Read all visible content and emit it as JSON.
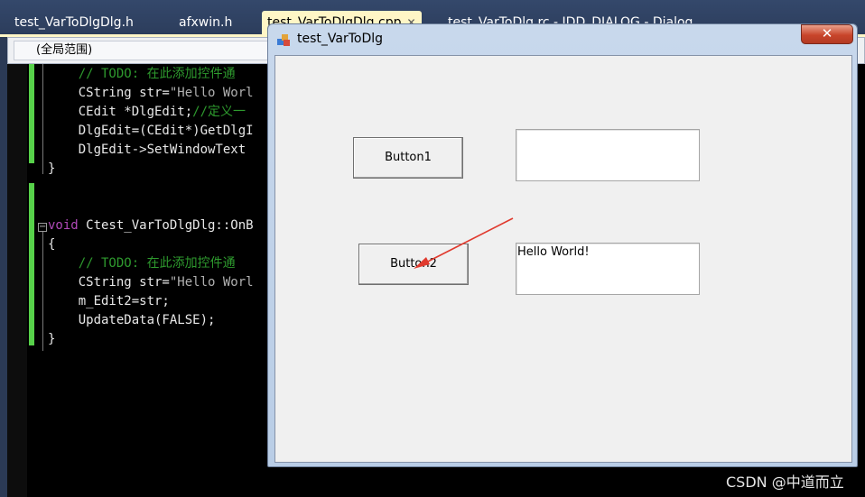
{
  "ide": {
    "tabs": [
      {
        "label": "test_VarToDlgDlg.h"
      },
      {
        "label": "afxwin.h"
      },
      {
        "label": "test_VarToDlgDlg.cpp",
        "close": "✕"
      },
      {
        "label": "test_VarToDlg.rc - IDD_DIALOG - Dialog"
      }
    ],
    "scope": "(全局范围)"
  },
  "code_lines": [
    {
      "indent": "    ",
      "parts": [
        {
          "cls": "c-comment",
          "text": "// TODO: 在此添加控件通"
        }
      ]
    },
    {
      "indent": "    ",
      "parts": [
        {
          "cls": "",
          "text": "CString str="
        },
        {
          "cls": "c-str",
          "text": "\"Hello Worl"
        }
      ]
    },
    {
      "indent": "    ",
      "parts": [
        {
          "cls": "",
          "text": "CEdit *DlgEdit;"
        },
        {
          "cls": "c-comment",
          "text": "//定义一"
        }
      ]
    },
    {
      "indent": "    ",
      "parts": [
        {
          "cls": "",
          "text": "DlgEdit=(CEdit*)GetDlgI"
        }
      ]
    },
    {
      "indent": "    ",
      "parts": [
        {
          "cls": "",
          "text": "DlgEdit->SetWindowText"
        }
      ]
    },
    {
      "indent": "",
      "parts": [
        {
          "cls": "",
          "text": "}"
        }
      ]
    },
    {
      "indent": "",
      "parts": []
    },
    {
      "indent": "",
      "parts": []
    },
    {
      "indent": "",
      "parts": [
        {
          "cls": "c-keyword",
          "text": "void"
        },
        {
          "cls": "",
          "text": " Ctest_VarToDlgDlg::OnB"
        }
      ]
    },
    {
      "indent": "",
      "parts": [
        {
          "cls": "",
          "text": "{"
        }
      ]
    },
    {
      "indent": "    ",
      "parts": [
        {
          "cls": "c-comment",
          "text": "// TODO: 在此添加控件通"
        }
      ]
    },
    {
      "indent": "    ",
      "parts": [
        {
          "cls": "",
          "text": "CString str="
        },
        {
          "cls": "c-str",
          "text": "\"Hello Worl"
        }
      ]
    },
    {
      "indent": "    ",
      "parts": [
        {
          "cls": "",
          "text": "m_Edit2=str;"
        }
      ]
    },
    {
      "indent": "    ",
      "parts": [
        {
          "cls": "",
          "text": "UpdateData(FALSE);"
        }
      ]
    },
    {
      "indent": "",
      "parts": [
        {
          "cls": "",
          "text": "}"
        }
      ]
    }
  ],
  "dialog": {
    "title": "test_VarToDlg",
    "close_glyph": "✕",
    "button1": "Button1",
    "button2": "Button2",
    "edit1": "",
    "edit2": "Hello World!"
  },
  "annotation": {
    "arrow_color": "#e03a2e"
  },
  "watermark": "CSDN @中道而立"
}
